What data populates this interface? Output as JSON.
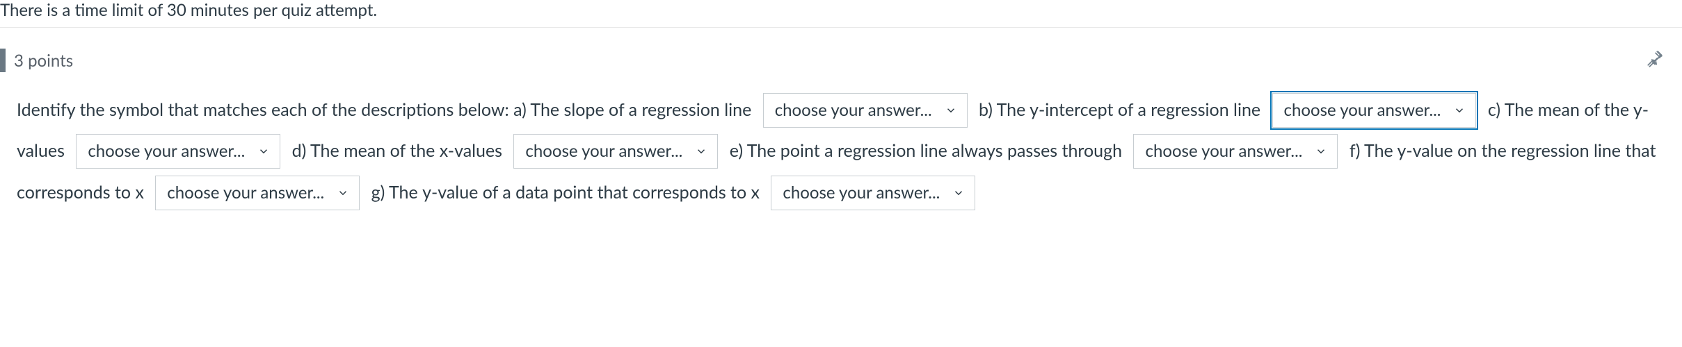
{
  "time_limit_text": "There is a time limit of 30 minutes per quiz attempt.",
  "points_label": "3 points",
  "question_intro": "Identify the symbol that matches each of the descriptions below: a) The slope of a regression line",
  "part_b": "b) The y-intercept of a regression line",
  "part_c": "c) The mean of the y-values",
  "part_d": "d) The mean of the x-values",
  "part_e_start": "e) The point a",
  "part_e_cont": "regression line always passes through",
  "part_f": "f) The y-value on the regression line that corresponds to x",
  "part_g_start": "g) The",
  "part_g_cont": "y-value of a data point that corresponds to x",
  "dropdown_placeholder": "choose your answer..."
}
